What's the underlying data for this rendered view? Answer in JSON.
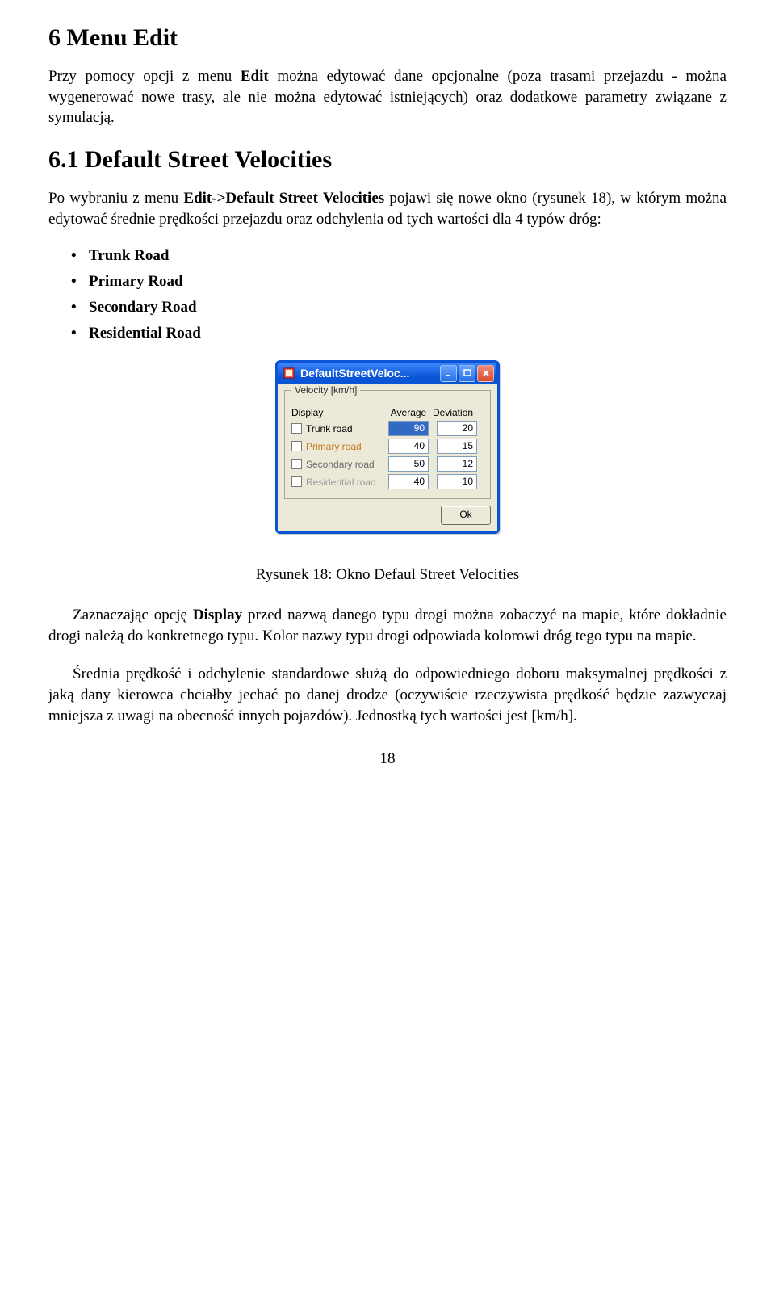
{
  "section": {
    "h1": "6   Menu Edit",
    "p1_a": "Przy pomocy opcji z menu ",
    "p1_b": "Edit",
    "p1_c": " można edytować dane opcjonalne (poza trasami przejazdu - można wygenerować nowe trasy, ale nie można edytować istniejących) oraz dodatkowe parametry związane z symulacją.",
    "h2": "6.1   Default Street Velocities",
    "p2_a": "Po wybraniu z menu ",
    "p2_b": "Edit->Default Street Velocities",
    "p2_c": " pojawi się nowe okno (rysunek 18), w którym można edytować średnie prędkości przejazdu oraz odchylenia od tych wartości dla 4 typów dróg:",
    "roads": [
      "Trunk Road",
      "Primary Road",
      "Secondary Road",
      "Residential Road"
    ],
    "caption": "Rysunek 18: Okno Defaul Street Velocities",
    "p3_a": "Zaznaczając opcję ",
    "p3_b": "Display",
    "p3_c": " przed nazwą danego typu drogi można zobaczyć na mapie, które dokładnie drogi należą do konkretnego typu. Kolor nazwy typu drogi odpowiada kolorowi dróg tego typu na mapie.",
    "p4": "Średnia prędkość i odchylenie standardowe służą do odpowiedniego doboru maksymalnej prędkości z jaką dany kierowca chciałby jechać po danej drodze (oczywiście rzeczywista prędkość będzie zazwyczaj mniejsza z uwagi na obecność innych pojazdów). Jednostką tych wartości jest [km/h].",
    "page_num": "18"
  },
  "dialog": {
    "title": "DefaultStreetVeloc...",
    "group_legend": "Velocity [km/h]",
    "col_display": "Display",
    "col_avg": "Average",
    "col_dev": "Deviation",
    "rows": [
      {
        "label": "Trunk road",
        "avg": "90",
        "dev": "20",
        "cls": "trunk",
        "focus": true
      },
      {
        "label": "Primary road",
        "avg": "40",
        "dev": "15",
        "cls": "primary",
        "focus": false
      },
      {
        "label": "Secondary road",
        "avg": "50",
        "dev": "12",
        "cls": "secondary",
        "focus": false
      },
      {
        "label": "Residential road",
        "avg": "40",
        "dev": "10",
        "cls": "residential",
        "focus": false
      }
    ],
    "ok": "Ok"
  }
}
